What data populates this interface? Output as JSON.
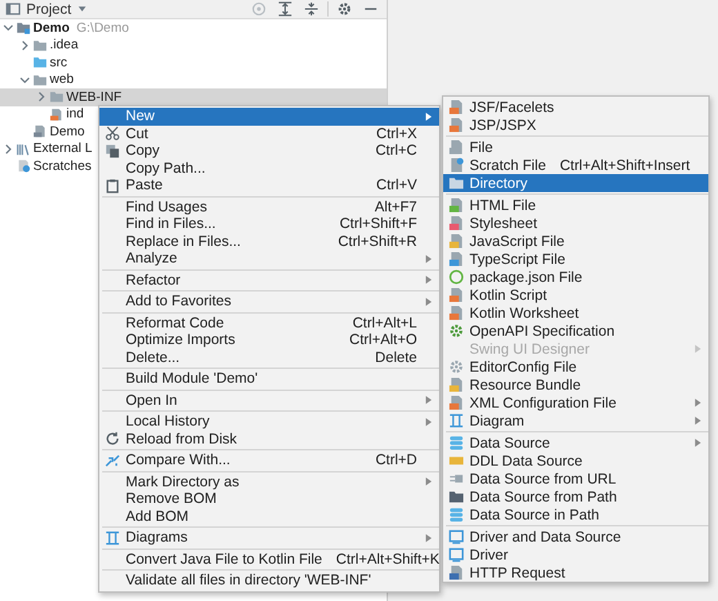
{
  "project_panel": {
    "title": "Project",
    "tree": [
      {
        "label": "Demo",
        "detail": "G:\\Demo",
        "kind": "module",
        "expandable": true,
        "expanded": true,
        "selected": false,
        "children": [
          {
            "label": ".idea",
            "kind": "folder",
            "expandable": true,
            "expanded": false,
            "selected": false
          },
          {
            "label": "src",
            "kind": "source-folder",
            "expandable": false,
            "selected": false
          },
          {
            "label": "web",
            "kind": "web-folder",
            "expandable": true,
            "expanded": true,
            "selected": false,
            "children": [
              {
                "label": "WEB-INF",
                "kind": "folder",
                "expandable": true,
                "expanded": false,
                "selected": true
              },
              {
                "label": "ind",
                "kind": "jsp",
                "expandable": false,
                "selected": false
              }
            ]
          },
          {
            "label": "Demo",
            "kind": "iml",
            "expandable": false,
            "selected": false
          }
        ]
      },
      {
        "label": "External L",
        "kind": "library",
        "expandable": true,
        "expanded": false,
        "selected": false
      },
      {
        "label": "Scratches",
        "kind": "scratch",
        "expandable": false,
        "selected": false
      }
    ]
  },
  "context_menu": {
    "groups": [
      [
        {
          "label": "New",
          "submenu": true,
          "selected": true
        },
        {
          "label": "Cut",
          "shortcut": "Ctrl+X",
          "kind": "cut",
          "submenu": false,
          "selected": false
        },
        {
          "label": "Copy",
          "shortcut": "Ctrl+C",
          "kind": "copy",
          "submenu": false,
          "selected": false
        },
        {
          "label": "Copy Path...",
          "submenu": false,
          "selected": false
        },
        {
          "label": "Paste",
          "shortcut": "Ctrl+V",
          "kind": "paste",
          "submenu": false,
          "selected": false
        }
      ],
      [
        {
          "label": "Find Usages",
          "shortcut": "Alt+F7",
          "submenu": false,
          "selected": false
        },
        {
          "label": "Find in Files...",
          "shortcut": "Ctrl+Shift+F",
          "submenu": false,
          "selected": false
        },
        {
          "label": "Replace in Files...",
          "shortcut": "Ctrl+Shift+R",
          "submenu": false,
          "selected": false
        },
        {
          "label": "Analyze",
          "submenu": true,
          "selected": false
        }
      ],
      [
        {
          "label": "Refactor",
          "submenu": true,
          "selected": false
        }
      ],
      [
        {
          "label": "Add to Favorites",
          "submenu": true,
          "selected": false
        }
      ],
      [
        {
          "label": "Reformat Code",
          "shortcut": "Ctrl+Alt+L",
          "submenu": false,
          "selected": false
        },
        {
          "label": "Optimize Imports",
          "shortcut": "Ctrl+Alt+O",
          "submenu": false,
          "selected": false
        },
        {
          "label": "Delete...",
          "shortcut": "Delete",
          "submenu": false,
          "selected": false
        }
      ],
      [
        {
          "label": "Build Module 'Demo'",
          "submenu": false,
          "selected": false
        }
      ],
      [
        {
          "label": "Open In",
          "submenu": true,
          "selected": false
        }
      ],
      [
        {
          "label": "Local History",
          "submenu": true,
          "selected": false
        },
        {
          "label": "Reload from Disk",
          "kind": "reload",
          "submenu": false,
          "selected": false
        }
      ],
      [
        {
          "label": "Compare With...",
          "shortcut": "Ctrl+D",
          "kind": "compare",
          "submenu": false,
          "selected": false
        }
      ],
      [
        {
          "label": "Mark Directory as",
          "submenu": true,
          "selected": false
        },
        {
          "label": "Remove BOM",
          "submenu": false,
          "selected": false
        },
        {
          "label": "Add BOM",
          "submenu": false,
          "selected": false
        }
      ],
      [
        {
          "label": "Diagrams",
          "kind": "diagram",
          "submenu": true,
          "selected": false
        }
      ],
      [
        {
          "label": "Convert Java File to Kotlin File",
          "shortcut": "Ctrl+Alt+Shift+K",
          "submenu": false,
          "selected": false
        }
      ],
      [
        {
          "label": "Validate all files in directory 'WEB-INF'",
          "submenu": false,
          "selected": false
        }
      ]
    ]
  },
  "new_submenu": {
    "groups": [
      [
        {
          "label": "JSF/Facelets",
          "kind": "jsf",
          "submenu": false,
          "selected": false,
          "disabled": false
        },
        {
          "label": "JSP/JSPX",
          "kind": "jsp",
          "submenu": false,
          "selected": false,
          "disabled": false
        }
      ],
      [
        {
          "label": "File",
          "kind": "file",
          "submenu": false,
          "selected": false,
          "disabled": false
        },
        {
          "label": "Scratch File",
          "shortcut": "Ctrl+Alt+Shift+Insert",
          "kind": "scratch",
          "submenu": false,
          "selected": false,
          "disabled": false
        },
        {
          "label": "Directory",
          "kind": "folder",
          "submenu": false,
          "selected": true,
          "disabled": false
        }
      ],
      [
        {
          "label": "HTML File",
          "kind": "html",
          "submenu": false,
          "selected": false,
          "disabled": false
        },
        {
          "label": "Stylesheet",
          "kind": "css",
          "submenu": false,
          "selected": false,
          "disabled": false
        },
        {
          "label": "JavaScript File",
          "kind": "js",
          "submenu": false,
          "selected": false,
          "disabled": false
        },
        {
          "label": "TypeScript File",
          "kind": "ts",
          "submenu": false,
          "selected": false,
          "disabled": false
        },
        {
          "label": "package.json File",
          "kind": "json",
          "submenu": false,
          "selected": false,
          "disabled": false
        },
        {
          "label": "Kotlin Script",
          "kind": "kotlin",
          "submenu": false,
          "selected": false,
          "disabled": false
        },
        {
          "label": "Kotlin Worksheet",
          "kind": "kotlin",
          "submenu": false,
          "selected": false,
          "disabled": false
        },
        {
          "label": "OpenAPI Specification",
          "kind": "openapi",
          "submenu": false,
          "selected": false,
          "disabled": false
        },
        {
          "label": "Swing UI Designer",
          "submenu": true,
          "selected": false,
          "disabled": true
        },
        {
          "label": "EditorConfig File",
          "kind": "gear",
          "submenu": false,
          "selected": false,
          "disabled": false
        },
        {
          "label": "Resource Bundle",
          "kind": "bundle",
          "submenu": false,
          "selected": false,
          "disabled": false
        },
        {
          "label": "XML Configuration File",
          "kind": "xml",
          "submenu": true,
          "selected": false,
          "disabled": false
        },
        {
          "label": "Diagram",
          "kind": "diagram",
          "submenu": true,
          "selected": false,
          "disabled": false
        }
      ],
      [
        {
          "label": "Data Source",
          "kind": "database",
          "submenu": true,
          "selected": false,
          "disabled": false
        },
        {
          "label": "DDL Data Source",
          "kind": "ddl",
          "submenu": false,
          "selected": false,
          "disabled": false
        },
        {
          "label": "Data Source from URL",
          "kind": "url",
          "submenu": false,
          "selected": false,
          "disabled": false
        },
        {
          "label": "Data Source from Path",
          "kind": "open-folder",
          "submenu": false,
          "selected": false,
          "disabled": false
        },
        {
          "label": "Data Source in Path",
          "kind": "database",
          "submenu": false,
          "selected": false,
          "disabled": false
        }
      ],
      [
        {
          "label": "Driver and Data Source",
          "kind": "driver",
          "submenu": false,
          "selected": false,
          "disabled": false
        },
        {
          "label": "Driver",
          "kind": "driver",
          "submenu": false,
          "selected": false,
          "disabled": false
        },
        {
          "label": "HTTP Request",
          "kind": "api",
          "submenu": false,
          "selected": false,
          "disabled": false
        }
      ]
    ]
  }
}
